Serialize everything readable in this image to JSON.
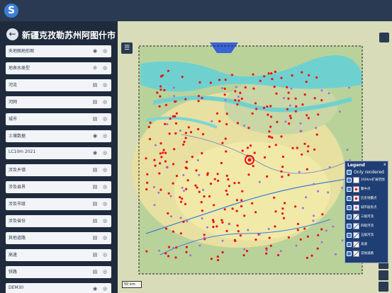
{
  "app": {
    "logo_glyph": "S"
  },
  "sidebar": {
    "title": "新疆克孜勒苏州阿图什市...",
    "back_icon": "arrow-left-icon",
    "layers": [
      {
        "label": "天地图地形图",
        "icons": [
          "eye-icon",
          "locate-icon"
        ]
      },
      {
        "label": "地表水类型",
        "icons": [
          "eye-slash-icon",
          "locate-icon"
        ]
      },
      {
        "label": "河流",
        "icons": [
          "table-icon",
          "locate-icon"
        ]
      },
      {
        "label": "河网",
        "icons": [
          "table-icon",
          "locate-icon"
        ]
      },
      {
        "label": "城市",
        "icons": [
          "table-icon",
          "locate-icon"
        ]
      },
      {
        "label": "土壤数据",
        "icons": [
          "eye-icon",
          "locate-icon"
        ]
      },
      {
        "label": "LC10m 2021",
        "icons": [
          "eye-icon",
          "locate-icon"
        ]
      },
      {
        "label": "涉及乡镇",
        "icons": [
          "table-icon",
          "locate-icon"
        ]
      },
      {
        "label": "涉及县界",
        "icons": [
          "table-icon",
          "locate-icon"
        ]
      },
      {
        "label": "涉及市级",
        "icons": [
          "table-icon",
          "locate-icon"
        ]
      },
      {
        "label": "涉及省份",
        "icons": [
          "table-icon",
          "locate-icon"
        ]
      },
      {
        "label": "其他道路",
        "icons": [
          "table-icon",
          "locate-icon"
        ]
      },
      {
        "label": "高速",
        "icons": [
          "table-icon",
          "locate-icon"
        ]
      },
      {
        "label": "铁路",
        "icons": [
          "table-icon",
          "locate-icon"
        ]
      },
      {
        "label": "DEM30",
        "icons": [
          "eye-icon",
          "locate-icon"
        ]
      }
    ]
  },
  "map": {
    "scale_label": "50 km",
    "legend": {
      "title": "Legend",
      "close": "x",
      "only_rendered": "Only rendered",
      "items": [
        {
          "label": "200km扩展范围",
          "symbol": "dashed-box"
        },
        {
          "label": "聚中点",
          "symbol": "red-dot"
        },
        {
          "label": "历史地震点",
          "symbol": "red-circle"
        },
        {
          "label": "城市居民点",
          "symbol": "purple-dot"
        },
        {
          "label": "三级河流",
          "symbol": "blue-line"
        },
        {
          "label": "四级河流",
          "symbol": "blue-line"
        },
        {
          "label": "五级河流",
          "symbol": "blue-line"
        },
        {
          "label": "高速",
          "symbol": "gray-line"
        },
        {
          "label": "其他道路",
          "symbol": "gray-line"
        }
      ]
    }
  }
}
